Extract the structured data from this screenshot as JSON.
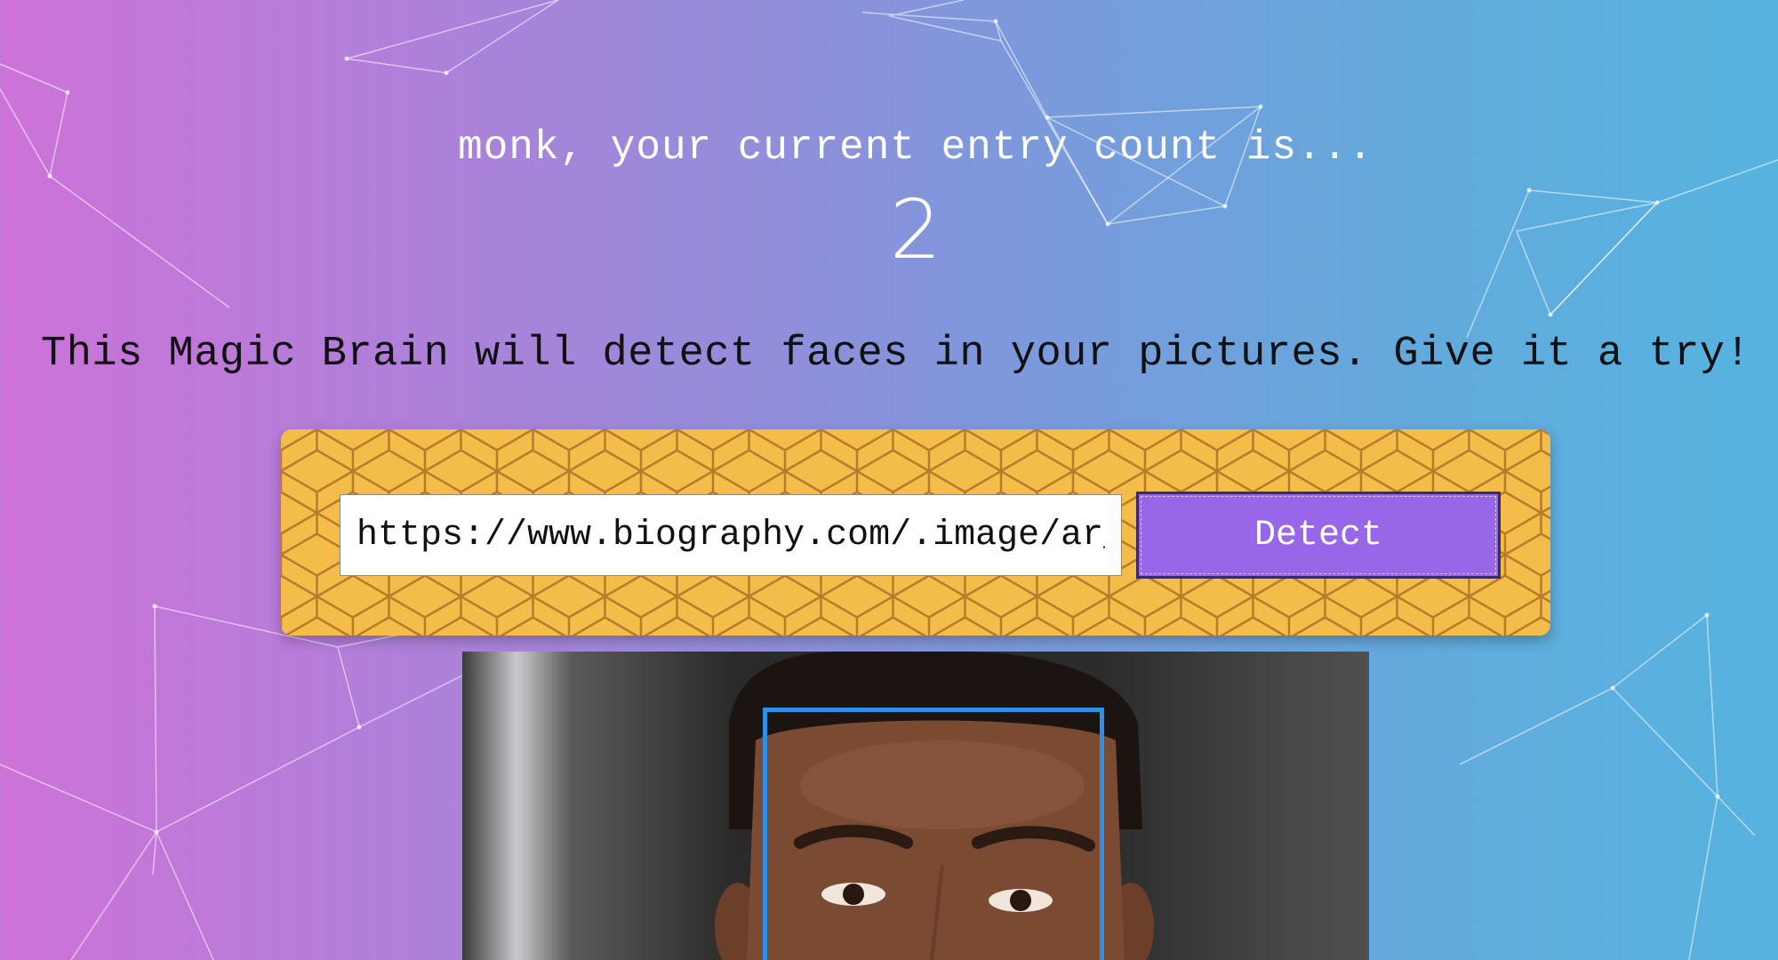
{
  "rank": {
    "message": "monk, your current entry count is...",
    "count": "2"
  },
  "tagline": "This Magic Brain will detect faces in your pictures. Give it a try!",
  "image_form": {
    "url_value": "https://www.biography.com/.image/ar_",
    "detect_label": "Detect"
  },
  "result": {
    "image_description": "portrait photo of a man with detected face box"
  },
  "colors": {
    "form_background": "#f4bd49",
    "button": "#9866e8",
    "face_box": "#2f8fe8"
  }
}
